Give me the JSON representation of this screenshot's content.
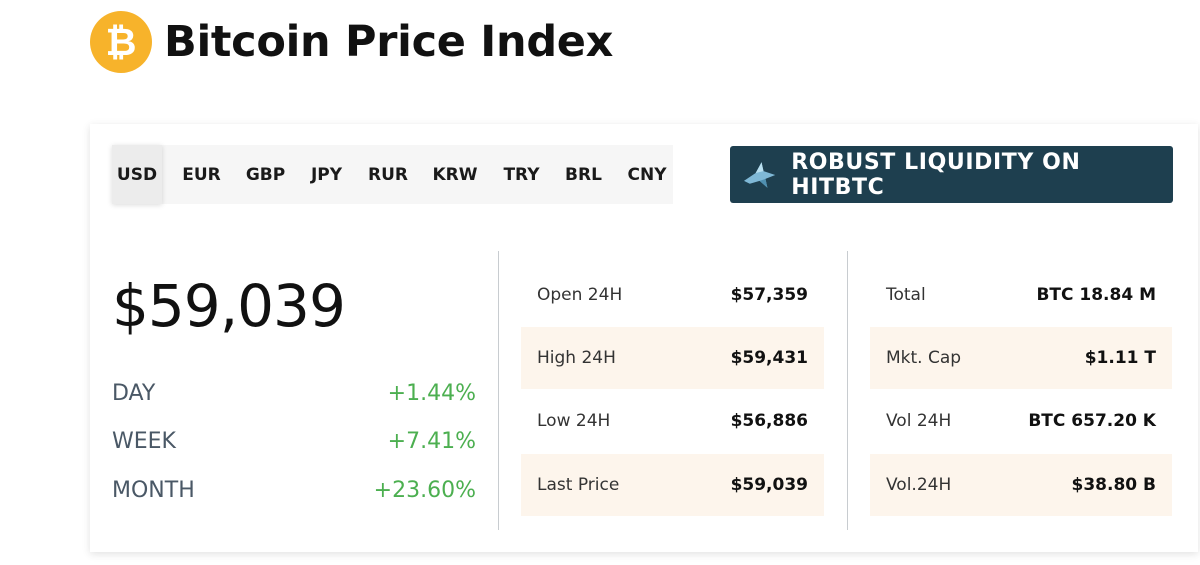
{
  "header": {
    "logo_symbol": "₿",
    "title": "Bitcoin Price Index"
  },
  "currency_tabs": [
    "USD",
    "EUR",
    "GBP",
    "JPY",
    "RUR",
    "KRW",
    "TRY",
    "BRL",
    "CNY"
  ],
  "active_currency": "USD",
  "promo": {
    "label": "ROBUST LIQUIDITY ON HITBTC",
    "icon": "hitbtc-shark-icon",
    "background": "#1e3f4f"
  },
  "price": "$59,039",
  "changes": [
    {
      "label": "DAY",
      "value": "+1.44%"
    },
    {
      "label": "WEEK",
      "value": "+7.41%"
    },
    {
      "label": "MONTH",
      "value": "+23.60%"
    }
  ],
  "stats_24h": [
    {
      "label": "Open 24H",
      "value": "$57,359"
    },
    {
      "label": "High 24H",
      "value": "$59,431"
    },
    {
      "label": "Low 24H",
      "value": "$56,886"
    },
    {
      "label": "Last Price",
      "value": "$59,039"
    }
  ],
  "market_stats": [
    {
      "label": "Total",
      "value": "BTC 18.84 M"
    },
    {
      "label": "Mkt. Cap",
      "value": "$1.11 T"
    },
    {
      "label": "Vol 24H",
      "value": "BTC 657.20 K"
    },
    {
      "label": "Vol.24H",
      "value": "$38.80 B"
    }
  ],
  "colors": {
    "logo": "#f7b32b",
    "positive_change": "#4caf50",
    "shaded_row": "#fdf5ec"
  }
}
